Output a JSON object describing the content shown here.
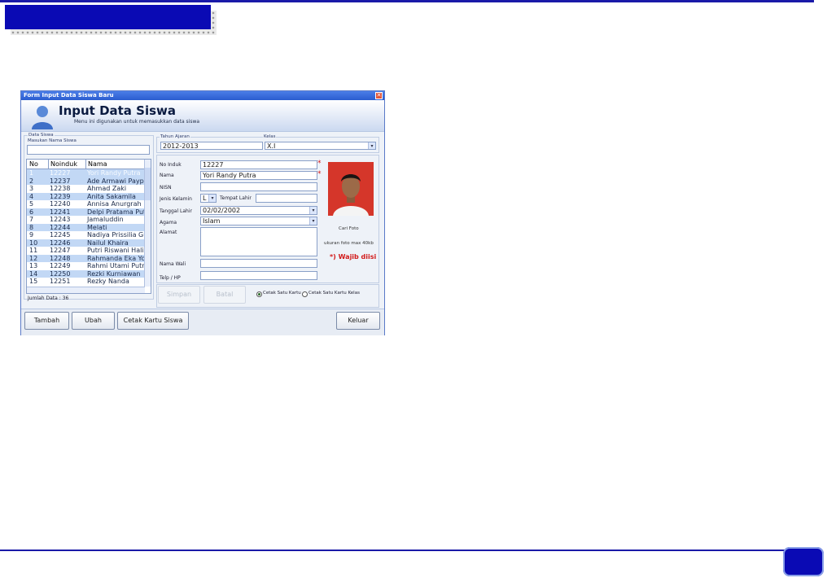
{
  "slide": {
    "colors": {
      "accent": "#0a0ab4",
      "line": "#1a1aa8"
    }
  },
  "window": {
    "title": "Form Input Data Siswa Baru",
    "close_glyph": "✕",
    "banner_title": "Input Data Siswa",
    "banner_subtitle": "Menu ini digunakan untuk memasukkan data siswa"
  },
  "left_panel": {
    "group_label": "Data Siswa",
    "search_label": "Masukan Nama Siswa",
    "search_value": "",
    "columns": [
      "No",
      "Noinduk",
      "Nama"
    ],
    "rows": [
      {
        "no": "1",
        "noinduk": "12227",
        "nama": "Yori Randy Putra"
      },
      {
        "no": "2",
        "noinduk": "12237",
        "nama": "Ade Armawi Paypa"
      },
      {
        "no": "3",
        "noinduk": "12238",
        "nama": "Ahmad Zaki"
      },
      {
        "no": "4",
        "noinduk": "12239",
        "nama": "Anita Sakamila"
      },
      {
        "no": "5",
        "noinduk": "12240",
        "nama": "Annisa Anurgrah"
      },
      {
        "no": "6",
        "noinduk": "12241",
        "nama": "Delpi Pratama Put"
      },
      {
        "no": "7",
        "noinduk": "12243",
        "nama": "Jamaluddin"
      },
      {
        "no": "8",
        "noinduk": "12244",
        "nama": "Melati"
      },
      {
        "no": "9",
        "noinduk": "12245",
        "nama": "Nadiya Prissilia Gu"
      },
      {
        "no": "10",
        "noinduk": "12246",
        "nama": "Nailul Khaira"
      },
      {
        "no": "11",
        "noinduk": "12247",
        "nama": "Putri Riswani Halir"
      },
      {
        "no": "12",
        "noinduk": "12248",
        "nama": "Rahmanda Eka Yo"
      },
      {
        "no": "13",
        "noinduk": "12249",
        "nama": "Rahmi Utami Putri"
      },
      {
        "no": "14",
        "noinduk": "12250",
        "nama": "Rezki Kurniawan"
      },
      {
        "no": "15",
        "noinduk": "12251",
        "nama": "Rezky Nanda"
      }
    ],
    "jumlah_label": "Jumlah Data : 36"
  },
  "form": {
    "tahun_ajaran_label": "Tahun Ajaran",
    "tahun_ajaran_value": "2012-2013",
    "kelas_label": "Kelas",
    "kelas_value": "X.I",
    "no_induk_label": "No Induk",
    "no_induk_value": "12227",
    "nama_label": "Nama",
    "nama_value": "Yori Randy Putra",
    "nisn_label": "NISN",
    "nisn_value": "",
    "jenis_kelamin_label": "Jenis Kelamin",
    "jenis_kelamin_value": "L",
    "tempat_lahir_label": "Tempat Lahir",
    "tempat_lahir_value": "",
    "tanggal_lahir_label": "Tanggal Lahir",
    "tanggal_lahir_value": "02/02/2002",
    "agama_label": "Agama",
    "agama_value": "Islam",
    "alamat_label": "Alamat",
    "alamat_value": "",
    "nama_wali_label": "Nama Wali",
    "nama_wali_value": "",
    "telp_label": "Telp / HP",
    "telp_value": "",
    "required_mark": "*",
    "cari_foto": "Cari Foto",
    "ukuran_foto": "ukuran foto max 40kb",
    "wajib": "*) Wajib diisi",
    "simpan": "Simpan",
    "batal": "Batal",
    "radio_satu": "Cetak Satu Kartu",
    "radio_kelas": "Cetak Satu Kartu Kelas",
    "radio_selected": "Cetak Satu Kartu"
  },
  "bottom_buttons": {
    "tambah": "Tambah",
    "ubah": "Ubah",
    "cetak": "Cetak Kartu Siswa",
    "keluar": "Keluar"
  }
}
